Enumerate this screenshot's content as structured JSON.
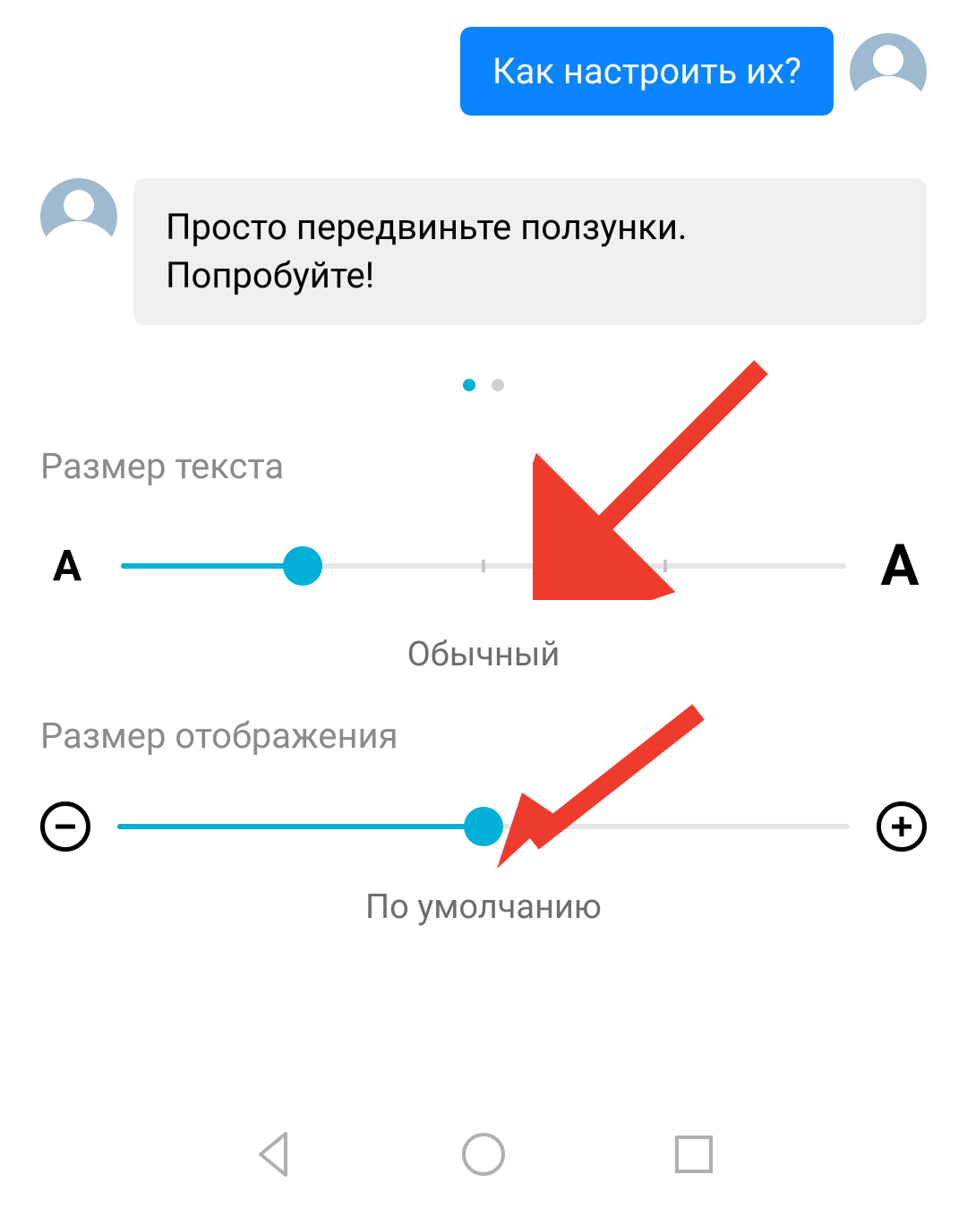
{
  "chat": {
    "outgoing": "Как настроить их?",
    "incoming": "Просто передвиньте ползунки. Попробуйте!"
  },
  "pagination": {
    "active_index": 0,
    "count": 2
  },
  "text_size": {
    "label": "Размер текста",
    "small_glyph": "A",
    "large_glyph": "A",
    "value_label": "Обычный",
    "fill_percent": 25,
    "ticks": [
      50,
      75
    ]
  },
  "display_size": {
    "label": "Размер отображения",
    "minus_glyph": "−",
    "plus_glyph": "+",
    "value_label": "По умолчанию",
    "fill_percent": 50
  },
  "colors": {
    "accent_blue": "#0a84ff",
    "slider_teal": "#00b0d6",
    "arrow_red": "#ef3b2d"
  }
}
